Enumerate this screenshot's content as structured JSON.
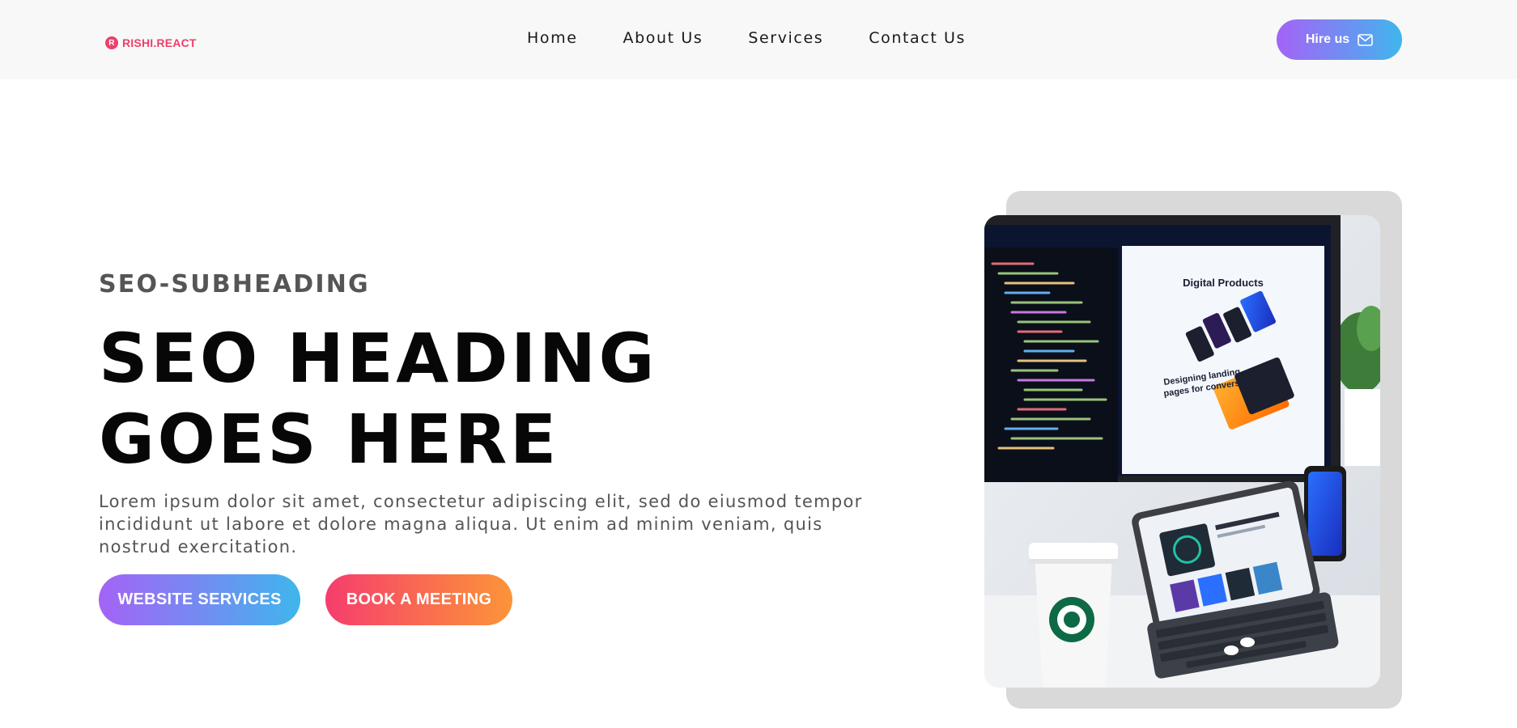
{
  "brand": {
    "name": "RISHI.REACT",
    "mark": "R",
    "color": "#ef3f6a"
  },
  "nav": {
    "items": [
      {
        "label": "Home"
      },
      {
        "label": "About Us"
      },
      {
        "label": "Services"
      },
      {
        "label": "Contact Us"
      }
    ],
    "hire_label": "Hire us",
    "hire_icon": "mail-icon"
  },
  "hero": {
    "subheading": "SEO-SUBHEADING",
    "heading": "SEO HEADING GOES HERE",
    "paragraph": "Lorem ipsum dolor sit amet, consectetur adipiscing elit, sed do eiusmod tempor incididunt ut labore et dolore magna aliqua. Ut enim ad minim veniam, quis nostrud exercitation.",
    "primary_cta": "WEBSITE SERVICES",
    "secondary_cta": "BOOK A MEETING",
    "image": {
      "screen_title": "Digital Products",
      "screen_subtitle_1": "Designing landing",
      "screen_subtitle_2": "pages for conversion"
    }
  },
  "colors": {
    "primary_gradient": [
      "#a463f6",
      "#3fb6ec"
    ],
    "secondary_gradient": [
      "#f63d6e",
      "#fc9438"
    ],
    "brand": "#ef3f6a"
  }
}
